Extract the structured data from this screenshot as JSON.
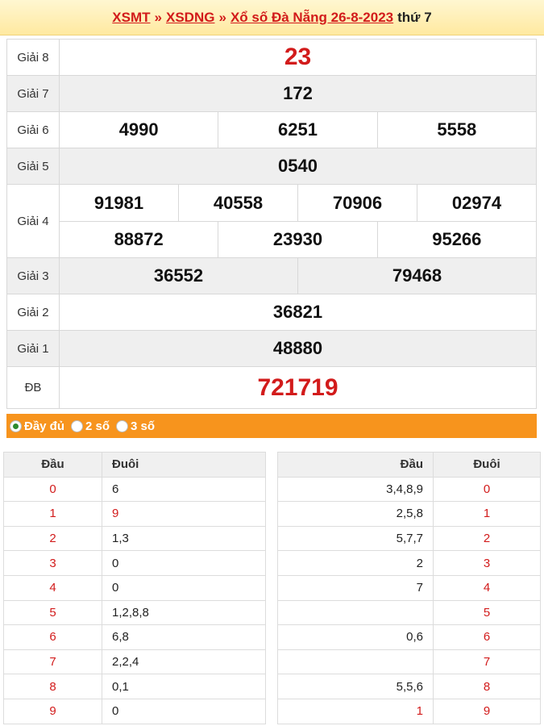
{
  "breadcrumb": {
    "link1": "XSMT",
    "sep1": "»",
    "link2": "XSDNG",
    "sep2": "»",
    "link3": "Xổ số Đà Nẵng 26-8-2023",
    "day": "thứ 7"
  },
  "prizes": {
    "g8": {
      "label": "Giải 8",
      "numbers": [
        "23"
      ]
    },
    "g7": {
      "label": "Giải 7",
      "numbers": [
        "172"
      ]
    },
    "g6": {
      "label": "Giải 6",
      "numbers": [
        "4990",
        "6251",
        "5558"
      ]
    },
    "g5": {
      "label": "Giải 5",
      "numbers": [
        "0540"
      ]
    },
    "g4": {
      "label": "Giải 4",
      "row1": [
        "91981",
        "40558",
        "70906",
        "02974"
      ],
      "row2": [
        "88872",
        "23930",
        "95266"
      ]
    },
    "g3": {
      "label": "Giải 3",
      "numbers": [
        "36552",
        "79468"
      ]
    },
    "g2": {
      "label": "Giải 2",
      "numbers": [
        "36821"
      ]
    },
    "g1": {
      "label": "Giải 1",
      "numbers": [
        "48880"
      ]
    },
    "db": {
      "label": "ĐB",
      "numbers": [
        "721719"
      ]
    }
  },
  "options": {
    "full": "Đầy đủ",
    "two": "2 số",
    "three": "3 số",
    "selected": "full"
  },
  "loto_left": {
    "headers": [
      "Đầu",
      "Đuôi"
    ],
    "rows": [
      [
        "0",
        "6"
      ],
      [
        "1",
        "9"
      ],
      [
        "2",
        "1,3"
      ],
      [
        "3",
        "0"
      ],
      [
        "4",
        "0"
      ],
      [
        "5",
        "1,2,8,8"
      ],
      [
        "6",
        "6,8"
      ],
      [
        "7",
        "2,2,4"
      ],
      [
        "8",
        "0,1"
      ],
      [
        "9",
        "0"
      ]
    ],
    "red_tail_rows": [
      1
    ]
  },
  "loto_right": {
    "headers": [
      "Đầu",
      "Đuôi"
    ],
    "rows": [
      [
        "3,4,8,9",
        "0"
      ],
      [
        "2,5,8",
        "1"
      ],
      [
        "5,7,7",
        "2"
      ],
      [
        "2",
        "3"
      ],
      [
        "7",
        "4"
      ],
      [
        "",
        "5"
      ],
      [
        "0,6",
        "6"
      ],
      [
        "",
        "7"
      ],
      [
        "5,5,6",
        "8"
      ],
      [
        "1",
        "9"
      ]
    ],
    "red_head_rows": [
      9
    ]
  },
  "colors": {
    "accent_red": "#d21b1b",
    "option_bar": "#f7941d",
    "header_bg": "#ffe9a0"
  }
}
